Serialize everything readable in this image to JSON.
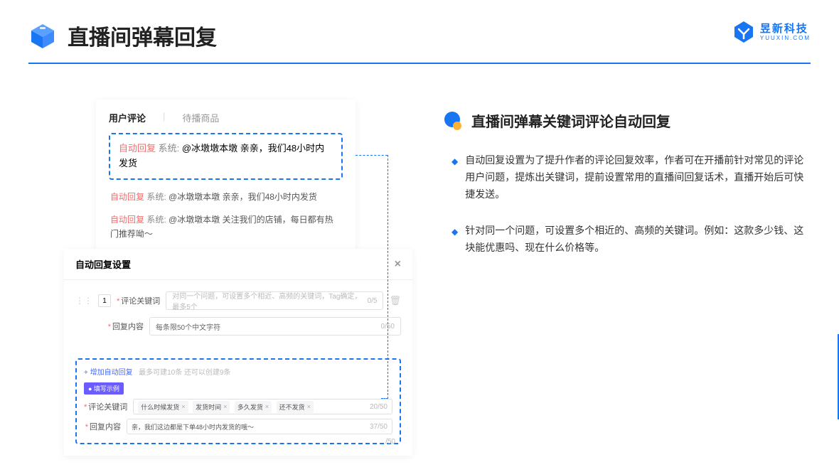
{
  "header": {
    "title": "直播间弹幕回复",
    "brand_cn": "昱新科技",
    "brand_en": "YUUXIN.COM"
  },
  "comments_card": {
    "tab_active": "用户评论",
    "tab_inactive": "待播商品",
    "highlighted": {
      "tag": "自动回复",
      "sys": "系统:",
      "text": "@冰墩墩本墩 亲亲，我们48小时内发货"
    },
    "line1": {
      "tag": "自动回复",
      "sys": "系统:",
      "text": "@冰墩墩本墩 亲亲，我们48小时内发货"
    },
    "line2": {
      "tag": "自动回复",
      "sys": "系统:",
      "text": "@冰墩墩本墩 关注我们的店铺，每日都有热门推荐呦～"
    }
  },
  "settings_card": {
    "title": "自动回复设置",
    "row_num": "1",
    "keyword_label": "评论关键词",
    "keyword_placeholder": "对同一个问题，可设置多个相近、高频的关键词，Tag确定，最多5个",
    "keyword_counter": "0/5",
    "content_label": "回复内容",
    "content_placeholder": "每条限50个中文字符",
    "content_counter": "0/50",
    "add_link": "+ 增加自动回复",
    "add_hint": "最多可建10条 还可以创建9条",
    "example_badge": "● 填写示例",
    "ex_keyword_label": "评论关键词",
    "ex_tags": [
      "什么时候发货",
      "发货时间",
      "多久发货",
      "还不发货"
    ],
    "ex_keyword_counter": "20/50",
    "ex_content_label": "回复内容",
    "ex_content_text": "亲，我们这边都是下单48小时内发货的哦～",
    "ex_content_counter": "37/50",
    "outer_counter": "/50"
  },
  "right": {
    "section_title": "直播间弹幕关键词评论自动回复",
    "bullet1": "自动回复设置为了提升作者的评论回复效率，作者可在开播前针对常见的评论用户问题，提炼出关键词，提前设置常用的直播间回复话术，直播开始后可快捷发送。",
    "bullet2": "针对同一个问题，可设置多个相近的、高频的关键词。例如：这款多少钱、这块能优惠吗、现在什么价格等。"
  }
}
